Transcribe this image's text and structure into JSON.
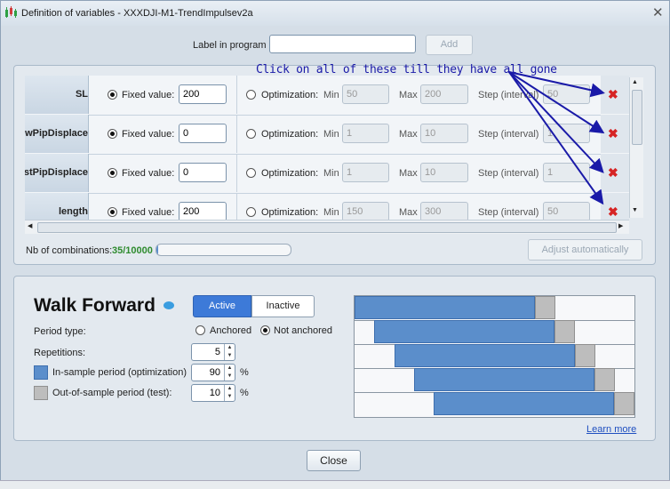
{
  "window": {
    "title": "Definition of variables - XXXDJI-M1-TrendImpulsev2a"
  },
  "label_in_program": {
    "label": "Label in program",
    "value": "",
    "add_label": "Add"
  },
  "annotation": "Click on all of these till they have all gone",
  "columns": {
    "fixed_label": "Fixed value:",
    "opt_label": "Optimization:",
    "min_label": "Min",
    "max_label": "Max",
    "step_label": "Step (interval)"
  },
  "variables": [
    {
      "name": "SL",
      "fixed": "200",
      "min": "50",
      "max": "200",
      "step": "50"
    },
    {
      "name": "LowPipDisplace",
      "fixed": "0",
      "min": "1",
      "max": "10",
      "step": "1"
    },
    {
      "name": "HighestPipDisplace",
      "fixed": "0",
      "min": "1",
      "max": "10",
      "step": "1"
    },
    {
      "name": "length",
      "fixed": "200",
      "min": "150",
      "max": "300",
      "step": "50"
    }
  ],
  "combinations": {
    "label": "Nb of combinations:",
    "value": "35/10000",
    "progress": 0.0035
  },
  "adjust_label": "Adjust automatically",
  "walk_forward": {
    "title": "Walk Forward",
    "active_label": "Active",
    "inactive_label": "Inactive",
    "period_type_label": "Period type:",
    "anchored_label": "Anchored",
    "not_anchored_label": "Not anchored",
    "repetitions_label": "Repetitions:",
    "repetitions": "5",
    "in_sample_label": "In-sample period (optimization)",
    "in_sample": "90",
    "out_sample_label": "Out-of-sample period (test):",
    "out_sample": "10",
    "percent": "%",
    "learn_more": "Learn more"
  },
  "close_label": "Close",
  "colors": {
    "accent": "#3d7ad8",
    "in_sample": "#5b8ecb",
    "out_sample": "#bdbdbd",
    "annotation": "#1a1aa8",
    "delete": "#d62424",
    "combinations": "#2e8b2e"
  }
}
